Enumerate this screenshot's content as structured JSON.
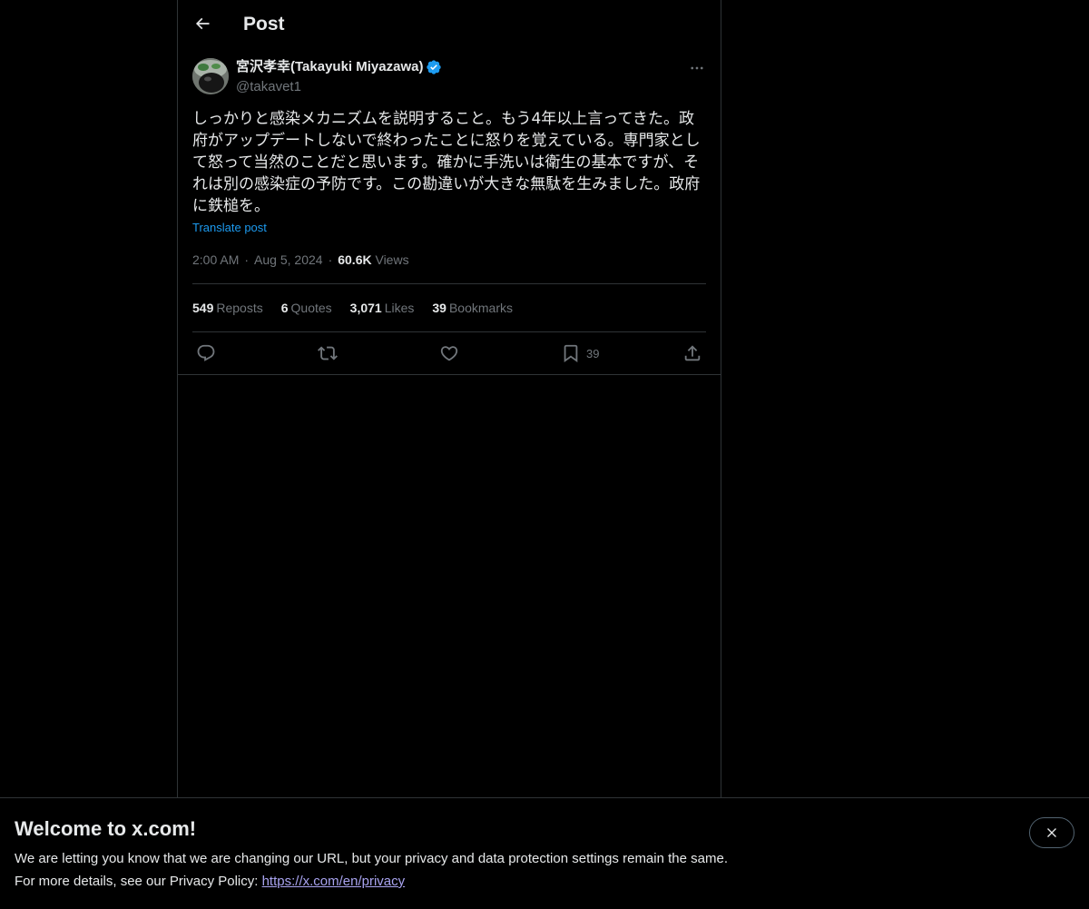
{
  "header": {
    "title": "Post"
  },
  "post": {
    "author_name": "宮沢孝幸(Takayuki Miyazawa)",
    "author_handle": "@takavet1",
    "text": "しっかりと感染メカニズムを説明すること。もう4年以上言ってきた。政府がアップデートしないで終わったことに怒りを覚えている。専門家として怒って当然のことだと思います。確かに手洗いは衛生の基本ですが、それは別の感染症の予防です。この勘違いが大きな無駄を生みました。政府に鉄槌を。",
    "translate_label": "Translate post",
    "time": "2:00 AM",
    "date": "Aug 5, 2024",
    "views_count": "60.6K",
    "views_label": "Views"
  },
  "stats": {
    "reposts_count": "549",
    "reposts_label": "Reposts",
    "quotes_count": "6",
    "quotes_label": "Quotes",
    "likes_count": "3,071",
    "likes_label": "Likes",
    "bookmarks_count": "39",
    "bookmarks_label": "Bookmarks"
  },
  "actions": {
    "bookmark_count": "39"
  },
  "banner": {
    "title": "Welcome to x.com!",
    "line1": "We are letting you know that we are changing our URL, but your privacy and data protection settings remain the same.",
    "line2_prefix": "For more details, see our Privacy Policy: ",
    "link": "https://x.com/en/privacy"
  },
  "colors": {
    "background": "#000000",
    "text": "#e7e9ea",
    "secondary": "#71767b",
    "accent": "#1d9bf0",
    "border": "#2f3336"
  },
  "icons": [
    "back-arrow-icon",
    "verified-badge-icon",
    "more-icon",
    "reply-icon",
    "repost-icon",
    "like-icon",
    "bookmark-icon",
    "share-icon",
    "close-icon"
  ]
}
